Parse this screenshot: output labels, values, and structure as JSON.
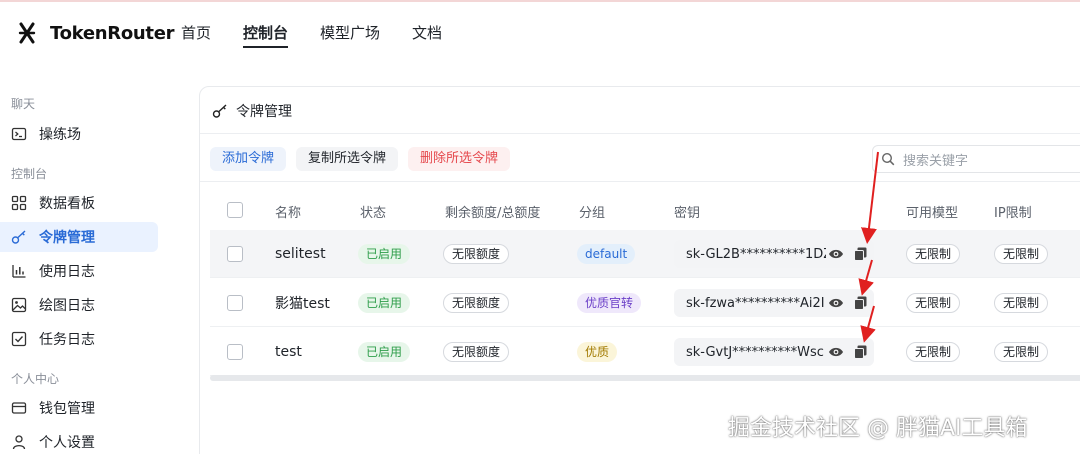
{
  "app": {
    "name": "TokenRouter"
  },
  "nav": {
    "items": [
      {
        "label": "首页",
        "active": false
      },
      {
        "label": "控制台",
        "active": true
      },
      {
        "label": "模型广场",
        "active": false
      },
      {
        "label": "文档",
        "active": false
      }
    ]
  },
  "sidebar": {
    "sections": [
      {
        "title": "聊天"
      },
      {
        "title": "控制台"
      },
      {
        "title": "个人中心"
      }
    ],
    "items": [
      {
        "label": "操练场",
        "icon": "terminal-icon"
      },
      {
        "label": "数据看板",
        "icon": "dashboard-icon"
      },
      {
        "label": "令牌管理",
        "icon": "key-icon",
        "active": true
      },
      {
        "label": "使用日志",
        "icon": "bar-chart-icon"
      },
      {
        "label": "绘图日志",
        "icon": "image-icon"
      },
      {
        "label": "任务日志",
        "icon": "checklist-icon"
      },
      {
        "label": "钱包管理",
        "icon": "wallet-icon"
      },
      {
        "label": "个人设置",
        "icon": "user-icon"
      }
    ]
  },
  "panel": {
    "title": "令牌管理",
    "toolbar": {
      "add": "添加令牌",
      "copy": "复制所选令牌",
      "delete": "删除所选令牌"
    },
    "search_placeholder": "搜索关键字"
  },
  "table": {
    "columns": [
      "名称",
      "状态",
      "剩余额度/总额度",
      "分组",
      "密钥",
      "可用模型",
      "IP限制"
    ],
    "rows": [
      {
        "name": "selitest",
        "status": "已启用",
        "quota": "无限额度",
        "group": "default",
        "group_color": "blue",
        "key": "sk-GL2B**********1DZb",
        "models": "无限制",
        "ip": "无限制"
      },
      {
        "name": "影猫test",
        "status": "已启用",
        "quota": "无限额度",
        "group": "优质官转",
        "group_color": "purple",
        "key": "sk-fzwa**********Ai2I",
        "models": "无限制",
        "ip": "无限制"
      },
      {
        "name": "test",
        "status": "已启用",
        "quota": "无限额度",
        "group": "优质",
        "group_color": "yellow",
        "key": "sk-GvtJ**********Wsc",
        "models": "无限制",
        "ip": "无限制"
      }
    ]
  },
  "colors": {
    "accent": "#2a6bd6",
    "danger": "#e5484d",
    "status_green": "#2f9e4b",
    "annotation_red": "#e02020"
  },
  "watermark": "掘金技术社区 @ 胖猫AI工具箱"
}
